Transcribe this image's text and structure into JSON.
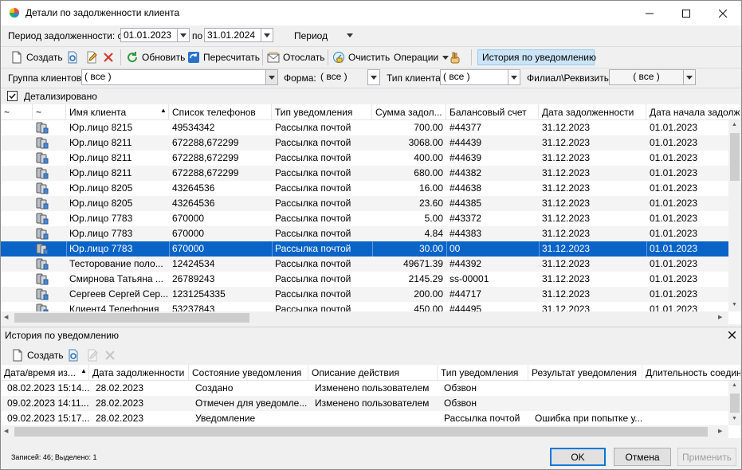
{
  "window": {
    "title": "Детали по задолженности клиента"
  },
  "period": {
    "label": "Период задолженности: с",
    "from": "01.01.2023",
    "to_label": "по",
    "to": "31.01.2024",
    "mode": "Период"
  },
  "toolbar": {
    "create": "Создать",
    "refresh": "Обновить",
    "recalc": "Пересчитать",
    "send": "Отослать",
    "clear": "Очистить",
    "operations": "Операции",
    "history_toggle": "История по уведомлению"
  },
  "filters": {
    "client_group_label": "Группа клиентов:",
    "client_group_value": "( все )",
    "form_label": "Форма:",
    "form_value": "( все )",
    "client_type_label": "Тип клиента:",
    "client_type_value": "( все )",
    "branch_label": "Филиал\\Реквизиты:",
    "branch_value": "( все )"
  },
  "detailed": {
    "label": "Детализировано",
    "checked": true
  },
  "main_grid": {
    "headers": [
      "~",
      "~",
      "Имя клиента",
      "Список телефонов",
      "Тип уведомления",
      "Сумма задол...",
      "Балансовый счет",
      "Дата задолженности",
      "Дата начала задолженности"
    ],
    "rows": [
      [
        "Юр.лицо 8215",
        "49534342",
        "Рассылка почтой",
        "700.00",
        "#44377",
        "31.12.2023",
        "01.01.2023"
      ],
      [
        "Юр.лицо 8211",
        "672288,672299",
        "Рассылка почтой",
        "3068.00",
        "#44439",
        "31.12.2023",
        "01.01.2023"
      ],
      [
        "Юр.лицо 8211",
        "672288,672299",
        "Рассылка почтой",
        "400.00",
        "#44639",
        "31.12.2023",
        "01.01.2023"
      ],
      [
        "Юр.лицо 8211",
        "672288,672299",
        "Рассылка почтой",
        "680.00",
        "#44382",
        "31.12.2023",
        "01.01.2023"
      ],
      [
        "Юр.лицо 8205",
        "43264536",
        "Рассылка почтой",
        "16.00",
        "#44638",
        "31.12.2023",
        "01.01.2023"
      ],
      [
        "Юр.лицо 8205",
        "43264536",
        "Рассылка почтой",
        "23.60",
        "#44385",
        "31.12.2023",
        "01.01.2023"
      ],
      [
        "Юр.лицо 7783",
        "670000",
        "Рассылка почтой",
        "5.00",
        "#43372",
        "31.12.2023",
        "01.01.2023"
      ],
      [
        "Юр.лицо 7783",
        "670000",
        "Рассылка почтой",
        "4.84",
        "#44383",
        "31.12.2023",
        "01.01.2023"
      ],
      [
        "Юр.лицо 7783",
        "670000",
        "Рассылка почтой",
        "30.00",
        "00",
        "31.12.2023",
        "01.01.2023"
      ],
      [
        "Тесторование поло...",
        "12424534",
        "Рассылка почтой",
        "49671.39",
        "#44392",
        "31.12.2023",
        "01.01.2023"
      ],
      [
        "Смирнова Татьяна ...",
        "26789243",
        "Рассылка почтой",
        "2145.29",
        "ss-00001",
        "31.12.2023",
        "01.01.2023"
      ],
      [
        "Сергеев Сергей Сер...",
        "1231254335",
        "Рассылка почтой",
        "200.00",
        "#44717",
        "31.12.2023",
        "01.01.2023"
      ],
      [
        "Клиент4 Телефония",
        "53237843",
        "Рассылка почтой",
        "450.00",
        "#44495",
        "31.12.2023",
        "01.01.2023"
      ]
    ],
    "selected_index": 8
  },
  "history": {
    "title": "История по уведомлению",
    "create": "Создать",
    "headers": [
      "Дата/время из...",
      "Дата задолженности",
      "Состояние уведомления",
      "Описание действия",
      "Тип уведомления",
      "Результат уведомления",
      "Длительность соединения"
    ],
    "rows": [
      [
        "08.02.2023 15:14...",
        "28.02.2023",
        "Создано",
        "Изменено пользователем",
        "Обзвон",
        ""
      ],
      [
        "09.02.2023 14:11...",
        "28.02.2023",
        "Отмечен для уведомле...",
        "Изменено пользователем",
        "Обзвон",
        ""
      ],
      [
        "09.02.2023 15:17...",
        "28.02.2023",
        "Уведомление",
        "",
        "Рассылка почтой",
        "Ошибка при попытке у..."
      ]
    ]
  },
  "status": {
    "text": "Записей: 46; Выделено: 1"
  },
  "buttons": {
    "ok": "OK",
    "cancel": "Отмена",
    "apply": "Применить"
  }
}
